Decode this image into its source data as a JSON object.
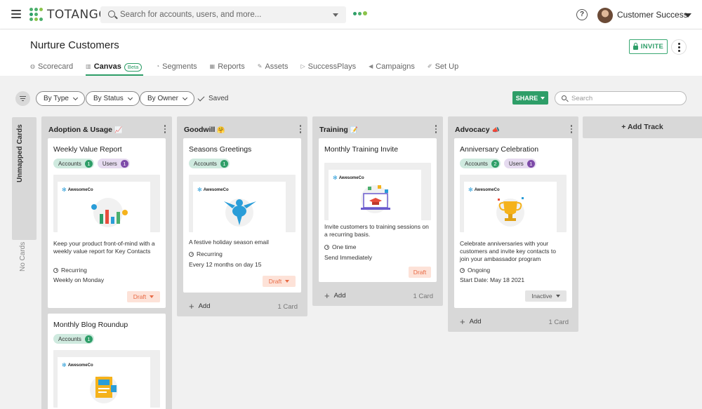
{
  "app": {
    "brand": "TOTANGO",
    "search_placeholder": "Search for accounts, users, and more...",
    "help": "?",
    "user": "Customer Success"
  },
  "page": {
    "title": "Nurture Customers",
    "invite_label": "INVITE",
    "tabs": [
      {
        "label": "Scorecard",
        "icon": "◍"
      },
      {
        "label": "Canvas",
        "icon": "▥",
        "badge": "Beta"
      },
      {
        "label": "Segments",
        "icon": "◔"
      },
      {
        "label": "Reports",
        "icon": "▦"
      },
      {
        "label": "Assets",
        "icon": "✎"
      },
      {
        "label": "SuccessPlays",
        "icon": "▷"
      },
      {
        "label": "Campaigns",
        "icon": "◀"
      },
      {
        "label": "Set Up",
        "icon": "✐"
      }
    ]
  },
  "toolbar": {
    "filters": [
      "By Type",
      "By Status",
      "By Owner"
    ],
    "saved": "Saved",
    "share": "SHARE",
    "search_placeholder": "Search"
  },
  "unmapped": {
    "title": "Unmapped Cards",
    "empty": "No Cards"
  },
  "tracks": [
    {
      "title": "Adoption & Usage",
      "emoji": "📈",
      "cards": [
        {
          "title": "Weekly Value Report",
          "chips": [
            {
              "label": "Accounts",
              "count": "1"
            },
            {
              "label": "Users",
              "count": "1"
            }
          ],
          "brand": "AwesomeCo",
          "description": "Keep your product front-of-mind with a weekly value report for Key Contacts",
          "schedule": "Recurring",
          "detail": "Weekly on Monday",
          "status": "Draft"
        },
        {
          "title": "Monthly Blog Roundup",
          "chips": [
            {
              "label": "Accounts",
              "count": "1"
            }
          ],
          "brand": "AwesomeCo"
        }
      ]
    },
    {
      "title": "Goodwill",
      "emoji": "🤗",
      "cards": [
        {
          "title": "Seasons Greetings",
          "chips": [
            {
              "label": "Accounts",
              "count": "1"
            }
          ],
          "brand": "AwesomeCo",
          "description": "A festive holiday season email",
          "schedule": "Recurring",
          "detail": "Every 12 months on day 15",
          "status": "Draft"
        }
      ],
      "add": "Add",
      "count": "1 Card"
    },
    {
      "title": "Training",
      "emoji": "📝",
      "cards": [
        {
          "title": "Monthly Training Invite",
          "brand": "AwesomeCo",
          "description": "Invite customers to training sessions on a recurring basis.",
          "schedule": "One time",
          "detail": "Send Immediately",
          "status": "Draft"
        }
      ],
      "add": "Add",
      "count": "1 Card"
    },
    {
      "title": "Advocacy",
      "emoji": "📣",
      "cards": [
        {
          "title": "Anniversary Celebration",
          "chips": [
            {
              "label": "Accounts",
              "count": "2"
            },
            {
              "label": "Users",
              "count": "1"
            }
          ],
          "brand": "AwesomeCo",
          "description": "Celebrate anniversaries with your customers and invite key contacts to join your ambassador program",
          "schedule": "Ongoing",
          "detail": "Start Date: May 18 2021",
          "status": "Inactive"
        }
      ],
      "add": "Add",
      "count": "1 Card"
    }
  ],
  "add_track": "+ Add Track",
  "colors": {
    "accent": "#2e9e68",
    "draft": "#e86a45",
    "users_chip": "#7d4aa8"
  }
}
